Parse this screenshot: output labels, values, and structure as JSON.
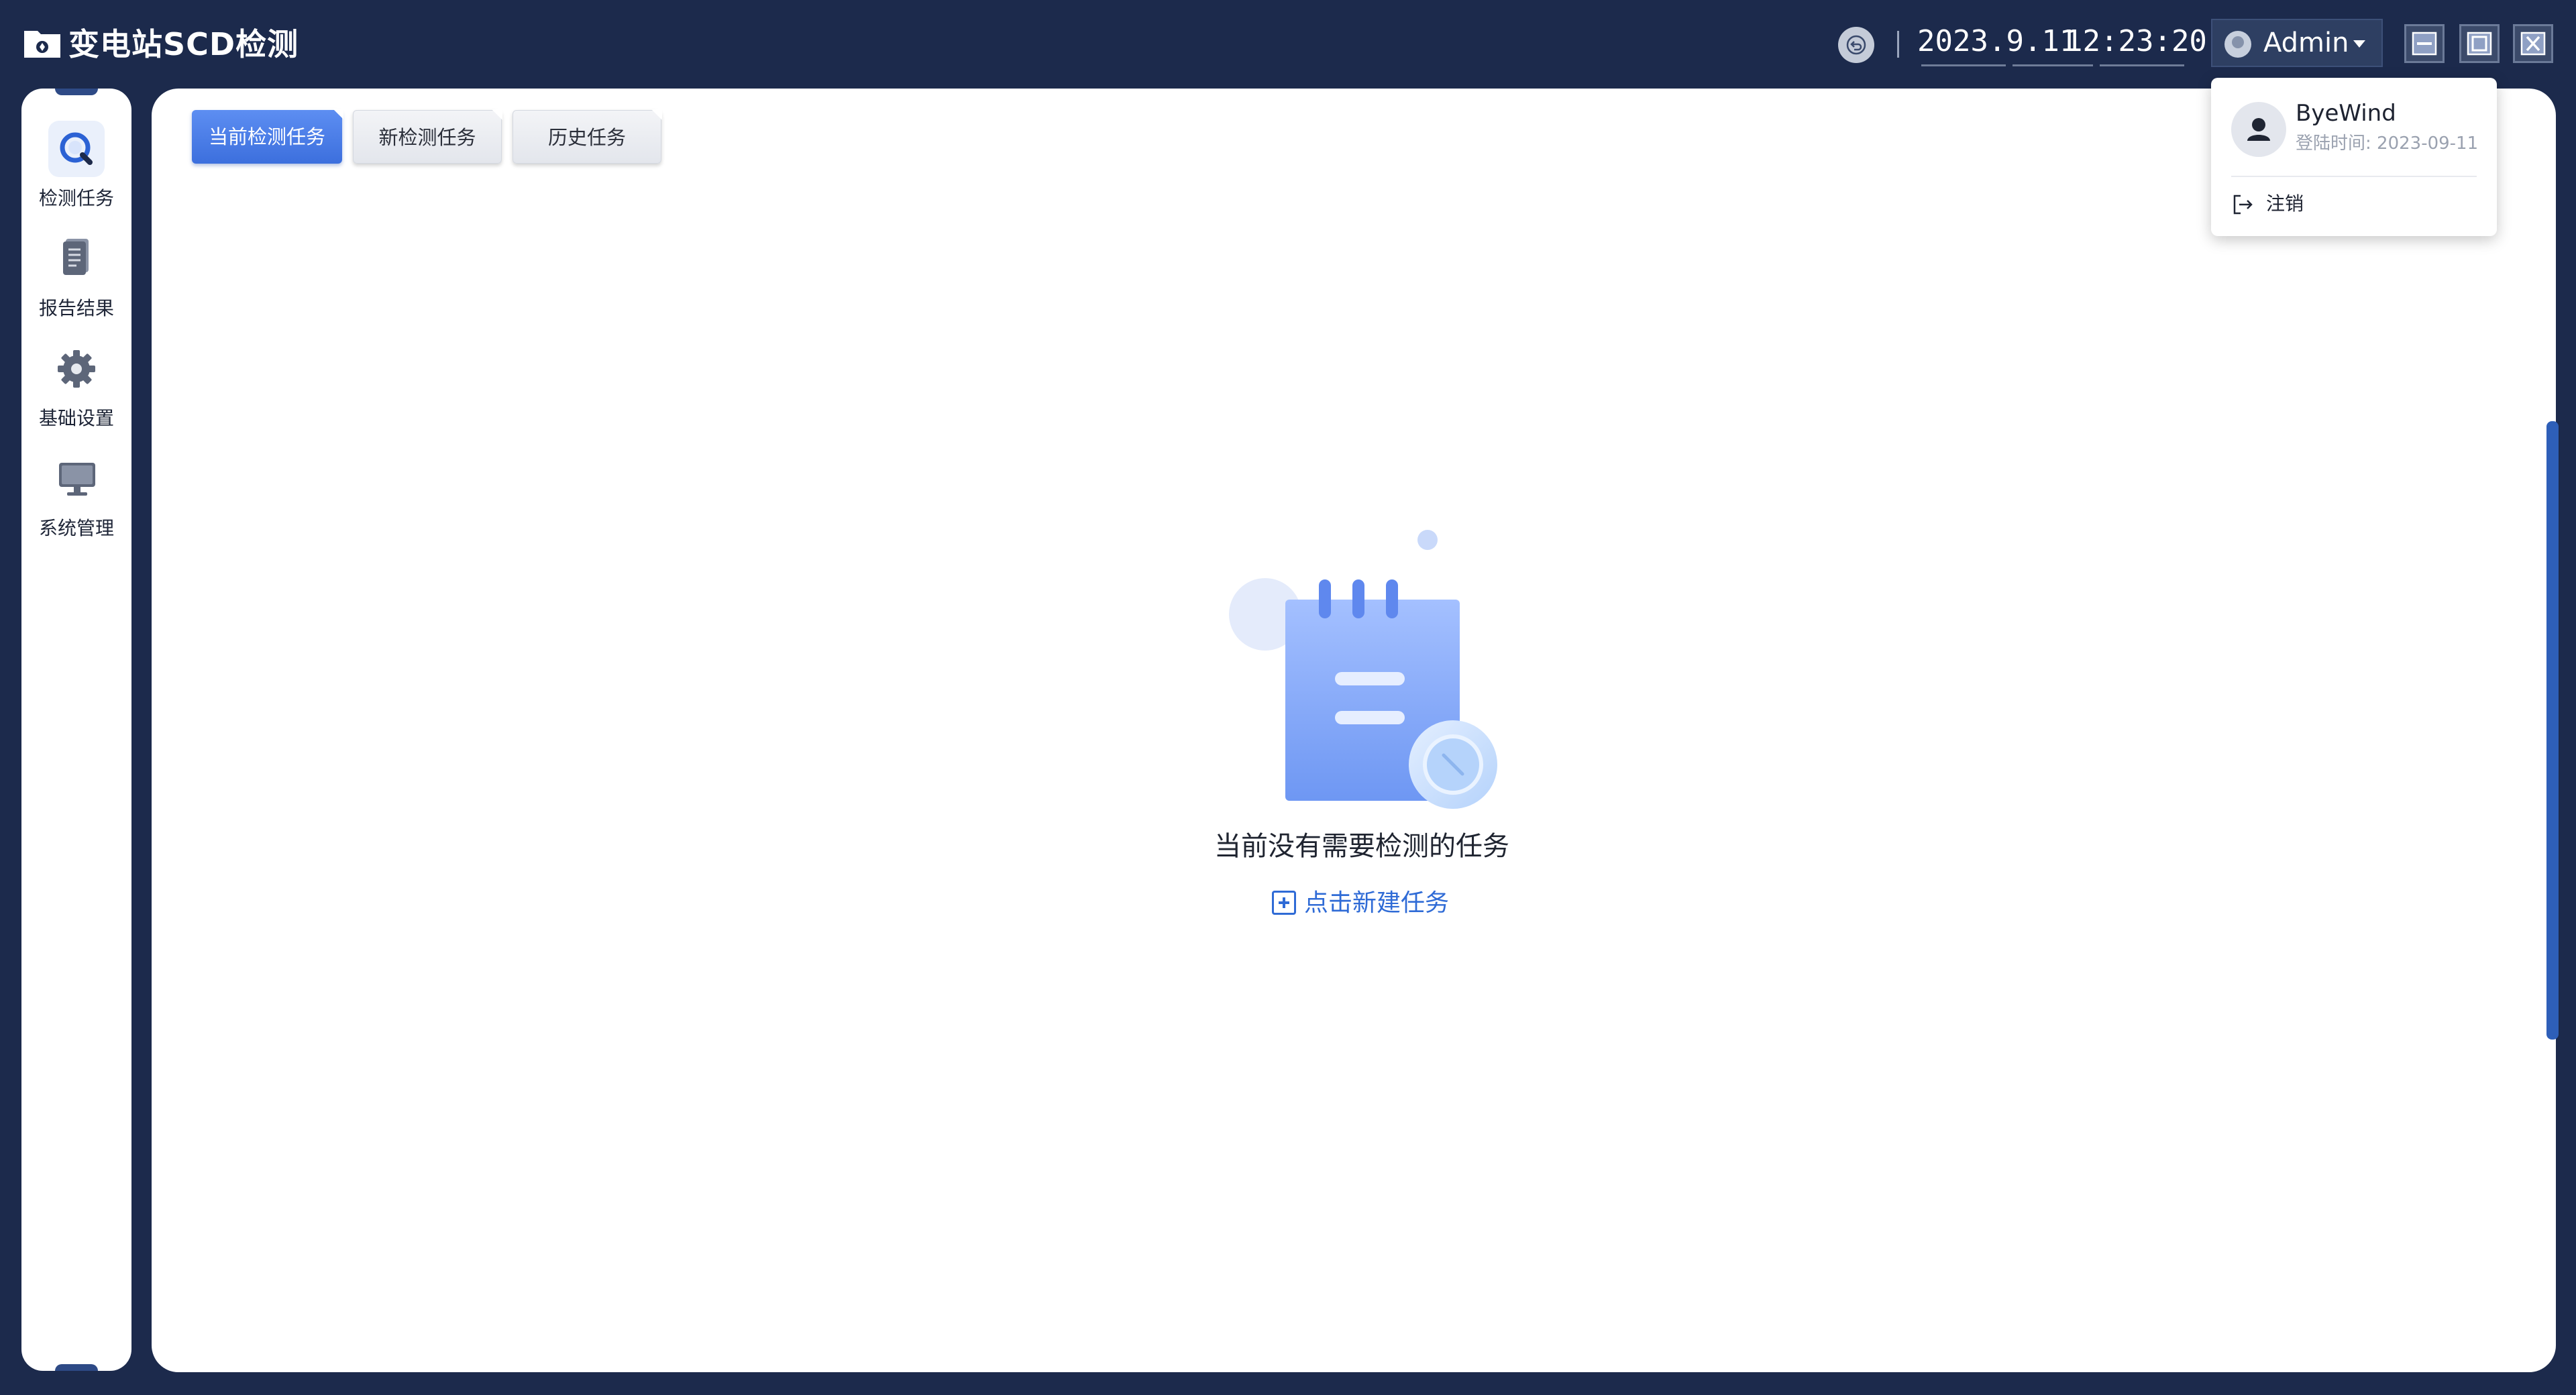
{
  "app": {
    "title": "变电站SCD检测"
  },
  "header": {
    "date": "2023.9.11",
    "time": "12:23:20",
    "user": "Admin"
  },
  "sidebar": {
    "items": [
      {
        "label": "检测任务",
        "icon": "magnifier-icon",
        "active": true
      },
      {
        "label": "报告结果",
        "icon": "report-icon",
        "active": false
      },
      {
        "label": "基础设置",
        "icon": "gear-icon",
        "active": false
      },
      {
        "label": "系统管理",
        "icon": "monitor-icon",
        "active": false
      }
    ]
  },
  "tabs": [
    {
      "label": "当前检测任务",
      "active": true
    },
    {
      "label": "新检测任务",
      "active": false
    },
    {
      "label": "历史任务",
      "active": false
    }
  ],
  "empty_state": {
    "message": "当前没有需要检测的任务",
    "action_label": "点击新建任务"
  },
  "user_dropdown": {
    "name": "ByeWind",
    "login_time": "登陆时间: 2023-09-11",
    "logout_label": "注销"
  },
  "colors": {
    "background": "#1c2a4c",
    "accent": "#3c6fdd",
    "link": "#2f6bd6"
  }
}
